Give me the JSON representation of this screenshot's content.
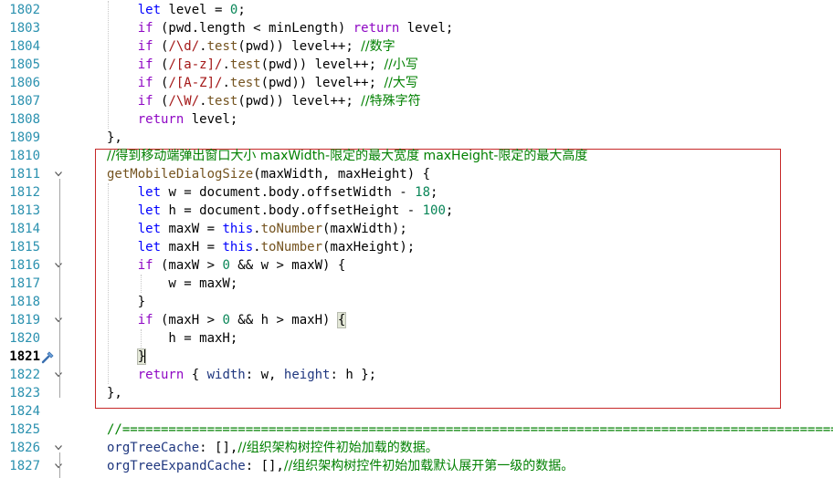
{
  "lines": [
    {
      "n": "1802",
      "fold": "",
      "tokens": [
        [
          "txt",
          "    "
        ],
        [
          "kw",
          "let"
        ],
        [
          "txt",
          " level = "
        ],
        [
          "num",
          "0"
        ],
        [
          "txt",
          ";"
        ]
      ]
    },
    {
      "n": "1803",
      "fold": "",
      "tokens": [
        [
          "txt",
          "    "
        ],
        [
          "ctl",
          "if"
        ],
        [
          "txt",
          " (pwd.length < minLength) "
        ],
        [
          "ctl",
          "return"
        ],
        [
          "txt",
          " level;"
        ]
      ]
    },
    {
      "n": "1804",
      "fold": "",
      "tokens": [
        [
          "txt",
          "    "
        ],
        [
          "ctl",
          "if"
        ],
        [
          "txt",
          " ("
        ],
        [
          "str",
          "/\\d/"
        ],
        [
          "txt",
          "."
        ],
        [
          "fn",
          "test"
        ],
        [
          "txt",
          "(pwd)) level++; "
        ],
        [
          "cmt",
          "//数字"
        ]
      ]
    },
    {
      "n": "1805",
      "fold": "",
      "tokens": [
        [
          "txt",
          "    "
        ],
        [
          "ctl",
          "if"
        ],
        [
          "txt",
          " ("
        ],
        [
          "str",
          "/[a-z]/"
        ],
        [
          "txt",
          "."
        ],
        [
          "fn",
          "test"
        ],
        [
          "txt",
          "(pwd)) level++; "
        ],
        [
          "cmt",
          "//小写"
        ]
      ]
    },
    {
      "n": "1806",
      "fold": "",
      "tokens": [
        [
          "txt",
          "    "
        ],
        [
          "ctl",
          "if"
        ],
        [
          "txt",
          " ("
        ],
        [
          "str",
          "/[A-Z]/"
        ],
        [
          "txt",
          "."
        ],
        [
          "fn",
          "test"
        ],
        [
          "txt",
          "(pwd)) level++; "
        ],
        [
          "cmt",
          "//大写"
        ]
      ]
    },
    {
      "n": "1807",
      "fold": "",
      "tokens": [
        [
          "txt",
          "    "
        ],
        [
          "ctl",
          "if"
        ],
        [
          "txt",
          " ("
        ],
        [
          "str",
          "/\\W/"
        ],
        [
          "txt",
          "."
        ],
        [
          "fn",
          "test"
        ],
        [
          "txt",
          "(pwd)) level++; "
        ],
        [
          "cmt",
          "//特殊字符"
        ]
      ]
    },
    {
      "n": "1808",
      "fold": "",
      "tokens": [
        [
          "txt",
          "    "
        ],
        [
          "ctl",
          "return"
        ],
        [
          "txt",
          " level;"
        ]
      ]
    },
    {
      "n": "1809",
      "fold": "",
      "tokens": [
        [
          "txt",
          "},"
        ]
      ]
    },
    {
      "n": "1810",
      "fold": "",
      "tokens": [
        [
          "cmt",
          "//得到移动端弹出窗口大小 maxWidth-限定的最大宽度 maxHeight-限定的最大高度"
        ]
      ]
    },
    {
      "n": "1811",
      "fold": "open",
      "tokens": [
        [
          "fn",
          "getMobileDialogSize"
        ],
        [
          "txt",
          "(maxWidth, maxHeight) {"
        ]
      ]
    },
    {
      "n": "1812",
      "fold": "",
      "tokens": [
        [
          "txt",
          "    "
        ],
        [
          "kw",
          "let"
        ],
        [
          "txt",
          " w = document.body.offsetWidth - "
        ],
        [
          "num",
          "18"
        ],
        [
          "txt",
          ";"
        ]
      ]
    },
    {
      "n": "1813",
      "fold": "",
      "tokens": [
        [
          "txt",
          "    "
        ],
        [
          "kw",
          "let"
        ],
        [
          "txt",
          " h = document.body.offsetHeight - "
        ],
        [
          "num",
          "100"
        ],
        [
          "txt",
          ";"
        ]
      ]
    },
    {
      "n": "1814",
      "fold": "",
      "tokens": [
        [
          "txt",
          "    "
        ],
        [
          "kw",
          "let"
        ],
        [
          "txt",
          " maxW = "
        ],
        [
          "kw",
          "this"
        ],
        [
          "txt",
          "."
        ],
        [
          "fn",
          "toNumber"
        ],
        [
          "txt",
          "(maxWidth);"
        ]
      ]
    },
    {
      "n": "1815",
      "fold": "",
      "tokens": [
        [
          "txt",
          "    "
        ],
        [
          "kw",
          "let"
        ],
        [
          "txt",
          " maxH = "
        ],
        [
          "kw",
          "this"
        ],
        [
          "txt",
          "."
        ],
        [
          "fn",
          "toNumber"
        ],
        [
          "txt",
          "(maxHeight);"
        ]
      ]
    },
    {
      "n": "1816",
      "fold": "open",
      "tokens": [
        [
          "txt",
          "    "
        ],
        [
          "ctl",
          "if"
        ],
        [
          "txt",
          " (maxW > "
        ],
        [
          "num",
          "0"
        ],
        [
          "txt",
          " && w > maxW) {"
        ]
      ]
    },
    {
      "n": "1817",
      "fold": "",
      "tokens": [
        [
          "txt",
          "        w = maxW;"
        ]
      ]
    },
    {
      "n": "1818",
      "fold": "",
      "tokens": [
        [
          "txt",
          "    }"
        ]
      ]
    },
    {
      "n": "1819",
      "fold": "open",
      "tokens": [
        [
          "txt",
          "    "
        ],
        [
          "ctl",
          "if"
        ],
        [
          "txt",
          " (maxH > "
        ],
        [
          "num",
          "0"
        ],
        [
          "txt",
          " && h > maxH) "
        ],
        [
          "bhl",
          "{"
        ]
      ]
    },
    {
      "n": "1820",
      "fold": "",
      "tokens": [
        [
          "txt",
          "        h = maxH;"
        ]
      ]
    },
    {
      "n": "1821",
      "fold": "",
      "current": true,
      "tokens": [
        [
          "txt",
          "    "
        ],
        [
          "bhl",
          "}"
        ],
        [
          "caret",
          ""
        ]
      ]
    },
    {
      "n": "1822",
      "fold": "open",
      "tokens": [
        [
          "txt",
          "    "
        ],
        [
          "ctl",
          "return"
        ],
        [
          "txt",
          " { "
        ],
        [
          "prop",
          "width"
        ],
        [
          "txt",
          ": w, "
        ],
        [
          "prop",
          "height"
        ],
        [
          "txt",
          ": h };"
        ]
      ]
    },
    {
      "n": "1823",
      "fold": "",
      "tokens": [
        [
          "txt",
          "},"
        ]
      ]
    },
    {
      "n": "1824",
      "fold": "",
      "tokens": []
    },
    {
      "n": "1825",
      "fold": "",
      "tokens": [
        [
          "cmt",
          "//============================================================================================="
        ]
      ]
    },
    {
      "n": "1826",
      "fold": "open",
      "tokens": [
        [
          "prop",
          "orgTreeCache"
        ],
        [
          "txt",
          ": [],"
        ],
        [
          "cmt",
          "//组织架构树控件初始加载的数据。"
        ]
      ]
    },
    {
      "n": "1827",
      "fold": "open",
      "tokens": [
        [
          "prop",
          "orgTreeExpandCache"
        ],
        [
          "txt",
          ": [],"
        ],
        [
          "cmt",
          "//组织架构树控件初始加载默认展开第一级的数据。"
        ]
      ]
    }
  ],
  "colors": {
    "line_number": "#2b91af",
    "keyword": "#0000ff",
    "control": "#8f08c4",
    "function": "#74531f",
    "string_regex": "#a31515",
    "comment": "#008000",
    "selection_box": "#c62828"
  },
  "icons": {
    "current_line": "screwdriver-icon",
    "fold": "chevron-down-icon"
  }
}
